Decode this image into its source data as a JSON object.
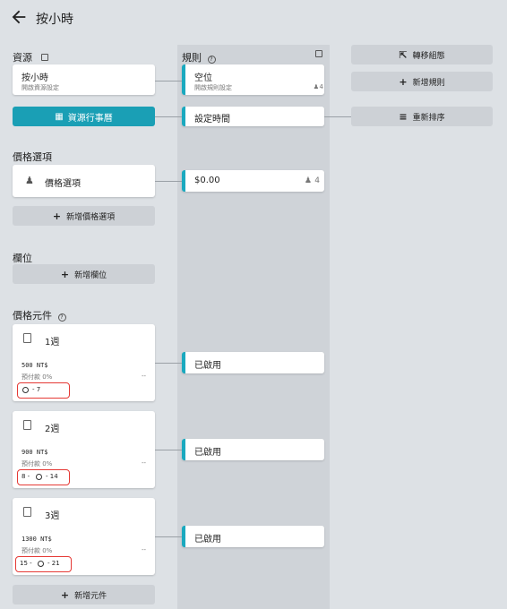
{
  "header": {
    "title": "按小時"
  },
  "resources": {
    "label": "資源",
    "card_title": "按小時",
    "card_sub": "開啟資源設定",
    "calendar_button": "資源行事曆"
  },
  "rules": {
    "label": "規則",
    "slot_title": "空位",
    "slot_sub": "開啟規則設定",
    "slot_count": "4",
    "set_time": "設定時間",
    "price": "$0.00",
    "price_count": "4",
    "enabled": [
      "已啟用",
      "已啟用",
      "已啟用"
    ]
  },
  "right_buttons": {
    "transfer": "轉移組態",
    "add_rule": "新增規則",
    "reorder": "重新排序"
  },
  "price_options": {
    "label": "價格選項",
    "card_label": "價格選項",
    "add_button": "新增價格選項"
  },
  "fields": {
    "label": "欄位",
    "add_button": "新增欄位"
  },
  "components": {
    "label": "價格元件",
    "items": [
      {
        "title": "1週",
        "price": "500 NT$",
        "deposit": "預付款 0%",
        "range": "- 7",
        "range_start": ""
      },
      {
        "title": "2週",
        "price": "900 NT$",
        "deposit": "預付款 0%",
        "range": "- 14",
        "range_start": "8 -"
      },
      {
        "title": "3週",
        "price": "1300 NT$",
        "deposit": "預付款 0%",
        "range": "- 21",
        "range_start": "15 -"
      }
    ],
    "more": "--",
    "add_button": "新增元件"
  }
}
